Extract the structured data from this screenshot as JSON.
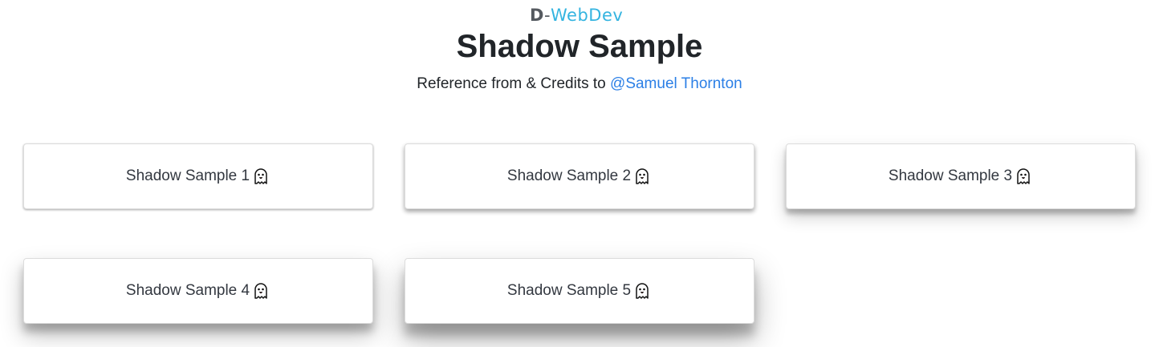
{
  "logo": {
    "mark": "D",
    "dash": "-",
    "text": "WebDev",
    "accent_color": "#34b4e0"
  },
  "page_title": "Shadow Sample",
  "subtitle": {
    "prefix": "Reference from & Credits to ",
    "link_text": "@Samuel Thornton",
    "link_color": "#2b7fe6"
  },
  "cards": [
    {
      "label": "Shadow Sample 1",
      "icon": "ghost-icon"
    },
    {
      "label": "Shadow Sample 2",
      "icon": "ghost-icon"
    },
    {
      "label": "Shadow Sample 3",
      "icon": "ghost-icon"
    },
    {
      "label": "Shadow Sample 4",
      "icon": "ghost-icon"
    },
    {
      "label": "Shadow Sample 5",
      "icon": "ghost-icon"
    }
  ]
}
